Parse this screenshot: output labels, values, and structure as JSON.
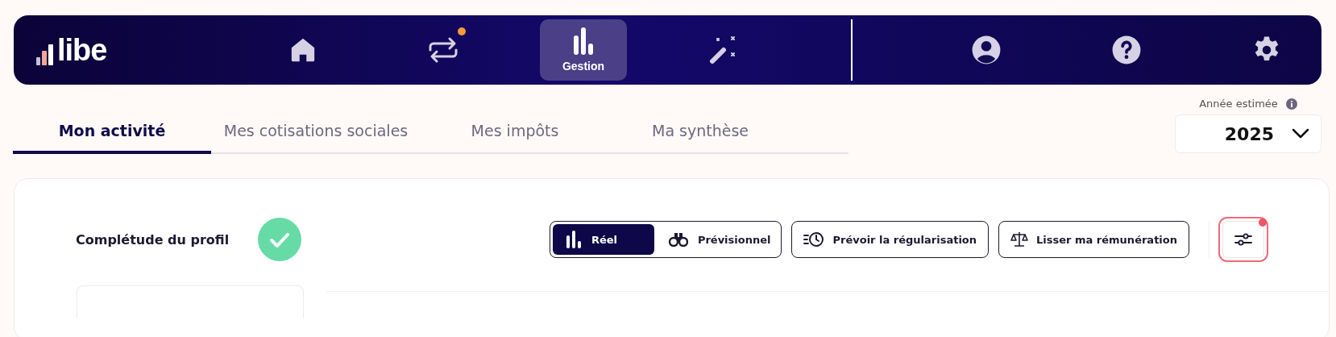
{
  "logo": {
    "text": "libe"
  },
  "nav": [
    {
      "kind": "home",
      "selected": false,
      "badge": false
    },
    {
      "kind": "transfer",
      "selected": false,
      "badge": true
    },
    {
      "kind": "chart",
      "label": "Gestion",
      "selected": true,
      "badge": false
    },
    {
      "kind": "wand",
      "selected": false,
      "badge": false
    }
  ],
  "nav_right": [
    {
      "kind": "user"
    },
    {
      "kind": "help"
    },
    {
      "kind": "settings"
    }
  ],
  "tabs": [
    {
      "label": "Mon activité",
      "selected": true
    },
    {
      "label": "Mes cotisations sociales",
      "selected": false
    },
    {
      "label": "Mes impôts",
      "selected": false
    },
    {
      "label": "Ma synthèse",
      "selected": false
    }
  ],
  "year": {
    "label": "Année estimée",
    "value": "2025"
  },
  "profile": {
    "label": "Complétude du profil",
    "complete": true
  },
  "mode_toggle": [
    {
      "kind": "chart",
      "label": "Réel",
      "selected": true
    },
    {
      "kind": "binoculars",
      "label": "Prévisionnel",
      "selected": false
    }
  ],
  "actions": [
    {
      "kind": "clock",
      "label": "Prévoir la régularisation"
    },
    {
      "kind": "scale",
      "label": "Lisser ma rémunération"
    }
  ],
  "filter": {
    "badge": true
  }
}
